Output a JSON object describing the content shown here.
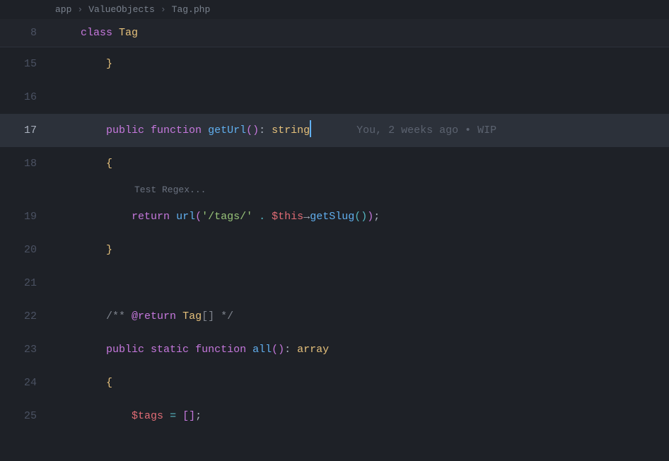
{
  "breadcrumb": {
    "seg1": "app",
    "seg2": "ValueObjects",
    "seg3": "Tag.php",
    "sep": "›"
  },
  "gutter": {
    "l8": "8",
    "l15": "15",
    "l16": "16",
    "l17": "17",
    "l18": "18",
    "l19": "19",
    "l20": "20",
    "l21": "21",
    "l22": "22",
    "l23": "23",
    "l24": "24",
    "l25": "25"
  },
  "code": {
    "l8": {
      "kw_class": "class",
      "sp": " ",
      "type_tag": "Tag"
    },
    "l15": {
      "indent": "        ",
      "brace": "}"
    },
    "l16": {
      "empty": ""
    },
    "l17": {
      "indent": "        ",
      "kw_public": "public",
      "sp1": " ",
      "kw_function": "function",
      "sp2": " ",
      "fn_name": "getUrl",
      "parens": "()",
      "colon": ": ",
      "type_string": "string"
    },
    "l18": {
      "indent": "        ",
      "brace": "{"
    },
    "l19": {
      "indent": "            ",
      "kw_return": "return",
      "sp1": " ",
      "fn_url": "url",
      "lp": "(",
      "str": "'/tags/'",
      "sp2": " ",
      "dot": ".",
      "sp3": " ",
      "this": "$this",
      "arrow": "→",
      "fn_getslug": "getSlug",
      "paren2": "()",
      "rp": ")",
      "semi": ";"
    },
    "l20": {
      "indent": "        ",
      "brace": "}"
    },
    "l21": {
      "empty": ""
    },
    "l22": {
      "indent": "        ",
      "c_open": "/** ",
      "doc_tag": "@return",
      "sp": " ",
      "type_tag": "Tag",
      "arr": "[]",
      "c_close": " */"
    },
    "l23": {
      "indent": "        ",
      "kw_public": "public",
      "sp1": " ",
      "kw_static": "static",
      "sp2": " ",
      "kw_function": "function",
      "sp3": " ",
      "fn_name": "all",
      "parens": "()",
      "colon": ": ",
      "type_array": "array"
    },
    "l24": {
      "indent": "        ",
      "brace": "{"
    },
    "l25": {
      "indent": "            ",
      "var": "$tags",
      "sp1": " ",
      "eq": "=",
      "sp2": " ",
      "lb": "[",
      "rb": "]",
      "semi": ";"
    }
  },
  "code_lens": {
    "test_regex": "Test Regex..."
  },
  "blame": {
    "l17": "You, 2 weeks ago • WIP"
  }
}
